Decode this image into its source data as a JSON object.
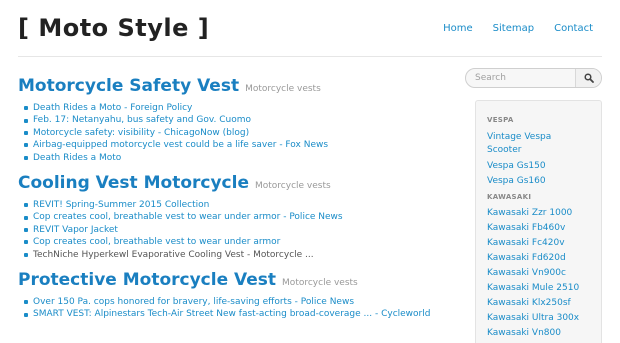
{
  "header": {
    "site_title": "[ Moto Style ]",
    "nav": [
      "Home",
      "Sitemap",
      "Contact"
    ]
  },
  "main": {
    "sections": [
      {
        "title": "Motorcycle Safety Vest",
        "category": "Motorcycle vests",
        "items": [
          {
            "text": "Death Rides a Moto - Foreign Policy",
            "link": true
          },
          {
            "text": "Feb. 17: Netanyahu, bus safety and Gov. Cuomo",
            "link": true
          },
          {
            "text": "Motorcycle safety: visibility - ChicagoNow (blog)",
            "link": true
          },
          {
            "text": "Airbag-equipped motorcycle vest could be a life saver - Fox News",
            "link": true
          },
          {
            "text": "Death Rides a Moto",
            "link": true
          }
        ]
      },
      {
        "title": "Cooling Vest Motorcycle",
        "category": "Motorcycle vests",
        "items": [
          {
            "text": "REVIT! Spring-Summer 2015 Collection",
            "link": true
          },
          {
            "text": "Cop creates cool, breathable vest to wear under armor - Police News",
            "link": true
          },
          {
            "text": "REVIT Vapor Jacket",
            "link": true
          },
          {
            "text": "Cop creates cool, breathable vest to wear under armor",
            "link": true
          },
          {
            "text": "TechNiche Hyperkewl Evaporative Cooling Vest - Motorcycle ...",
            "link": false
          }
        ]
      },
      {
        "title": "Protective Motorcycle Vest",
        "category": "Motorcycle vests",
        "items": [
          {
            "text": "Over 150 Pa. cops honored for bravery, life-saving efforts - Police News",
            "link": true
          },
          {
            "text": "SMART VEST: Alpinestars Tech-Air Street New fast-acting broad-coverage ... - Cycleworld",
            "link": true
          }
        ]
      }
    ]
  },
  "sidebar": {
    "search_placeholder": "Search",
    "search_icon": "search-icon",
    "groups": [
      {
        "heading": "VESPA",
        "items": [
          "Vintage Vespa Scooter",
          "Vespa Gs150",
          "Vespa Gs160"
        ]
      },
      {
        "heading": "KAWASAKI",
        "items": [
          "Kawasaki Zzr 1000",
          "Kawasaki Fb460v",
          "Kawasaki Fc420v",
          "Kawasaki Fd620d",
          "Kawasaki Vn900c",
          "Kawasaki Mule 2510",
          "Kawasaki Klx250sf",
          "Kawasaki Ultra 300x",
          "Kawasaki Vn800"
        ]
      }
    ]
  },
  "colors": {
    "link": "#1a8cc8",
    "title": "#1a7fc0",
    "muted": "#999999"
  }
}
